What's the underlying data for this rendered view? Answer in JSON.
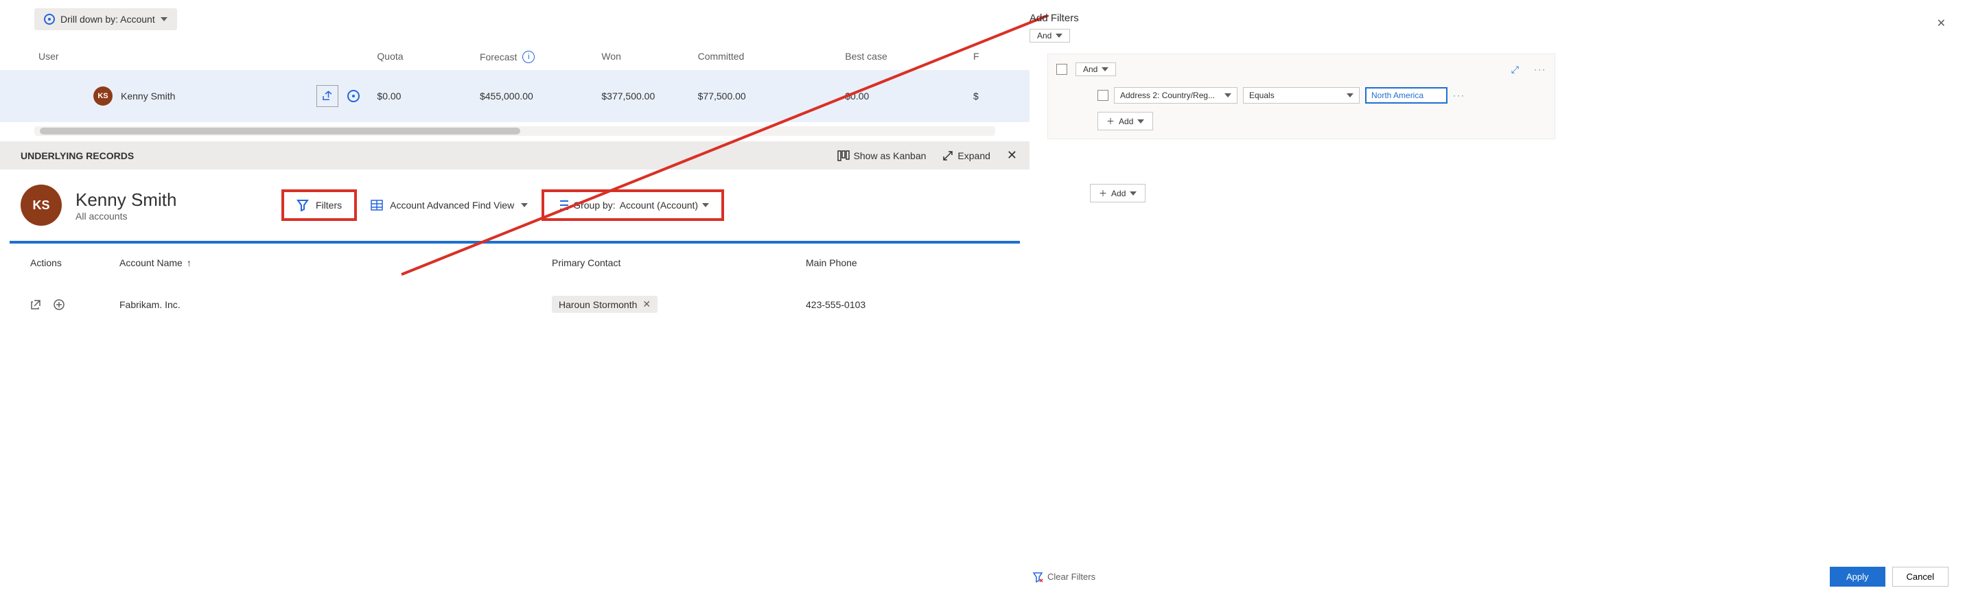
{
  "drilldown": {
    "label": "Drill down by: Account"
  },
  "grid": {
    "headers": {
      "user": "User",
      "quota": "Quota",
      "forecast": "Forecast",
      "won": "Won",
      "committed": "Committed",
      "bestcase": "Best case",
      "extra": "F"
    },
    "row": {
      "initials": "KS",
      "name": "Kenny Smith",
      "quota": "$0.00",
      "forecast": "$455,000.00",
      "won": "$377,500.00",
      "committed": "$77,500.00",
      "bestcase": "$0.00",
      "extra": "$"
    }
  },
  "underlying": {
    "label": "UNDERLYING RECORDS",
    "kanban": "Show as Kanban",
    "expand": "Expand"
  },
  "record_header": {
    "initials": "KS",
    "name": "Kenny Smith",
    "sub": "All accounts",
    "filters_label": "Filters",
    "view_label": "Account Advanced Find View",
    "groupby_label": "Group by:",
    "groupby_value": "Account (Account)"
  },
  "accounts": {
    "headers": {
      "actions": "Actions",
      "name": "Account Name",
      "contact": "Primary Contact",
      "phone": "Main Phone"
    },
    "row": {
      "name": "Fabrikam. Inc.",
      "contact": "Haroun Stormonth",
      "phone": "423-555-0103"
    }
  },
  "filters_panel": {
    "title": "Add Filters",
    "and": "And",
    "field": "Address 2: Country/Reg...",
    "operator": "Equals",
    "value": "North America",
    "add": "Add"
  },
  "footer": {
    "clear": "Clear Filters",
    "apply": "Apply",
    "cancel": "Cancel"
  }
}
